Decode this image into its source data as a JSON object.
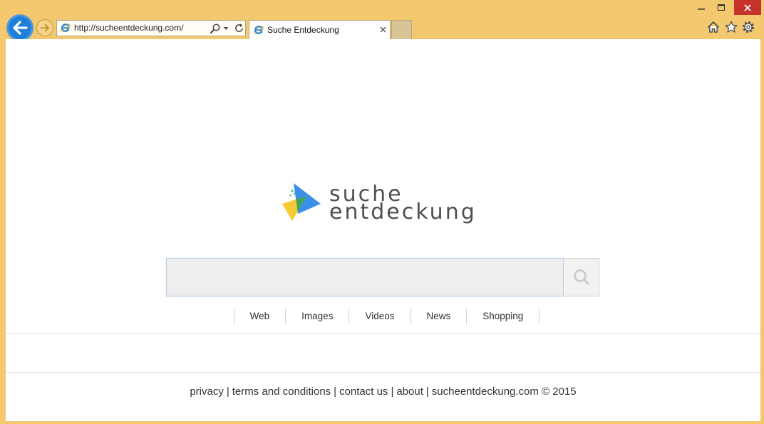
{
  "browser": {
    "address": "http://sucheentdeckung.com/",
    "tab_title": "Suche Entdeckung"
  },
  "logo": {
    "line1": "suche",
    "line2": "entdeckung"
  },
  "search": {
    "value": ""
  },
  "nav": [
    "Web",
    "Images",
    "Videos",
    "News",
    "Shopping"
  ],
  "footer": {
    "links": [
      "privacy",
      "terms and conditions",
      "contact us",
      "about"
    ],
    "separator": "|",
    "copyright": "sucheentdeckung.com © 2015"
  },
  "icons": {
    "back": "back-arrow-icon",
    "forward": "forward-arrow-icon",
    "site": "ie-icon",
    "address_search": "search-icon",
    "address_dropdown": "chevron-down-icon",
    "refresh": "refresh-icon",
    "tab_close": "close-icon",
    "home": "home-icon",
    "favorites": "star-icon",
    "tools": "gear-icon",
    "search_button": "magnifier-icon",
    "minimize": "minimize-icon",
    "maximize": "maximize-icon",
    "close": "close-icon"
  },
  "colors": {
    "frame": "#F3C86F",
    "close": "#C7332C",
    "back": "#1D7FD8",
    "logo_blue": "#3C8FE8",
    "logo_yellow": "#F7C934",
    "logo_green": "#3BA55C",
    "logo_dots": "#4CB8A0"
  }
}
